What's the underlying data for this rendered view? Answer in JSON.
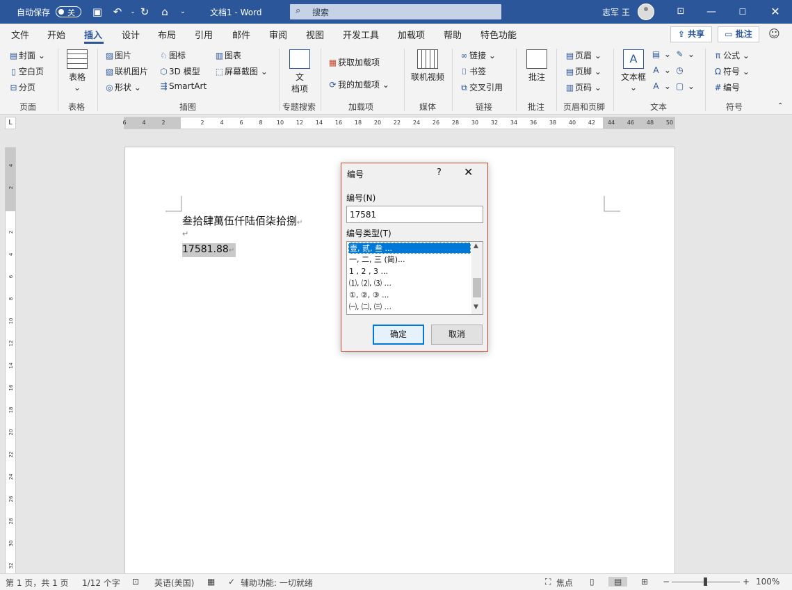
{
  "titlebar": {
    "autosave_label": "自动保存",
    "autosave_state": "关",
    "doc_title": "文档1 - Word",
    "search_placeholder": "搜索",
    "user_name": "志军 王"
  },
  "tabs": [
    "文件",
    "开始",
    "插入",
    "设计",
    "布局",
    "引用",
    "邮件",
    "审阅",
    "视图",
    "开发工具",
    "加载项",
    "帮助",
    "特色功能"
  ],
  "active_tab": "插入",
  "share_label": "共享",
  "comments_label": "批注",
  "ribbon": {
    "pages": {
      "items": [
        "封面",
        "空白页",
        "分页"
      ],
      "group": "页面"
    },
    "table": {
      "label": "表格",
      "group": "表格"
    },
    "illustrations": {
      "items": [
        "图片",
        "联机图片",
        "形状",
        "图标",
        "3D 模型",
        "SmartArt",
        "图表",
        "屏幕截图"
      ],
      "group": "插图"
    },
    "search": {
      "label": "文档项",
      "label_top": "文",
      "label_bottom": "档项",
      "group": "专题搜索"
    },
    "addins": {
      "items": [
        "获取加载项",
        "我的加载项"
      ],
      "group": "加载项"
    },
    "media": {
      "label": "联机视频",
      "group": "媒体"
    },
    "links": {
      "items": [
        "链接",
        "书签",
        "交叉引用"
      ],
      "group": "链接"
    },
    "comments": {
      "label": "批注",
      "group": "批注"
    },
    "headerfooter": {
      "items": [
        "页眉",
        "页脚",
        "页码"
      ],
      "group": "页眉和页脚"
    },
    "text": {
      "label": "文本框",
      "group": "文本"
    },
    "symbols": {
      "items": [
        "公式",
        "符号",
        "编号"
      ],
      "group": "符号"
    }
  },
  "ruler": {
    "h_ticks": [
      "6",
      "4",
      "2",
      "",
      "2",
      "4",
      "6",
      "8",
      "10",
      "12",
      "14",
      "16",
      "18",
      "20",
      "22",
      "24",
      "26",
      "28",
      "30",
      "32",
      "34",
      "36",
      "38",
      "40",
      "42",
      "44",
      "46",
      "48",
      "50"
    ],
    "v_ticks": [
      "4",
      "2",
      "",
      "2",
      "4",
      "6",
      "8",
      "10",
      "12",
      "14",
      "16",
      "18",
      "20",
      "22",
      "24",
      "26",
      "28",
      "30",
      "32"
    ]
  },
  "document": {
    "line1": "叁拾肆萬伍仟陆佰柒拾捌",
    "line3": "17581.88",
    "paragraph_mark": "↵"
  },
  "dialog": {
    "title": "编号",
    "help": "?",
    "number_label": "编号(N)",
    "number_value": "17581",
    "type_label": "编号类型(T)",
    "types": [
      "壹, 贰, 叁 ...",
      "一, 二, 三 (简)...",
      "1 , 2 , 3  ...",
      "⑴, ⑵, ⑶ ...",
      "①, ②, ③ ...",
      "㈠, ㈡, ㈢ ..."
    ],
    "selected_index": 0,
    "ok_label": "确定",
    "cancel_label": "取消"
  },
  "statusbar": {
    "page": "第 1 页，共 1 页",
    "words": "1/12 个字",
    "language": "英语(美国)",
    "accessibility": "辅助功能: 一切就绪",
    "focus": "焦点",
    "zoom": "100%"
  }
}
